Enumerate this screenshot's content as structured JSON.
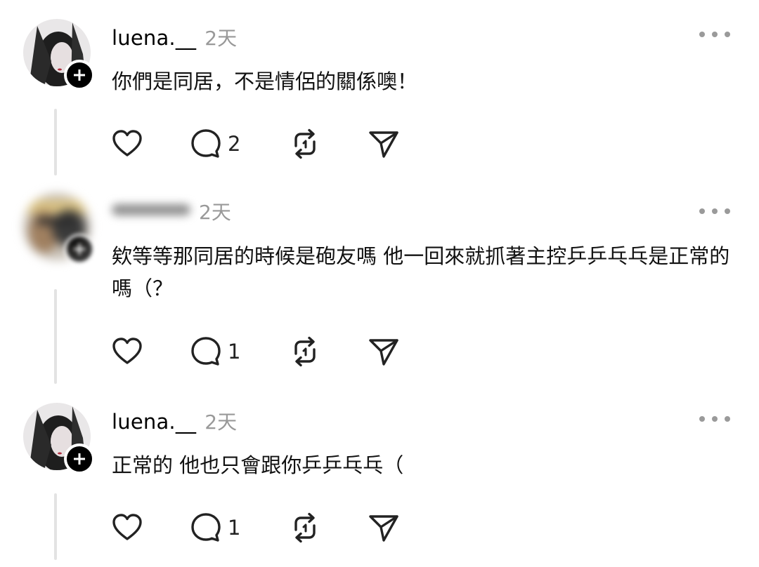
{
  "comments": [
    {
      "username": "luena.__",
      "time": "2天",
      "text": "你們是同居，不是情侶的關係噢！",
      "reply_count": "2"
    },
    {
      "username": "",
      "time": "2天",
      "text": "欸等等那同居的時候是砲友嗎 他一回來就抓著主控乒乒乓乓是正常的嗎（？",
      "reply_count": "1"
    },
    {
      "username": "luena.__",
      "time": "2天",
      "text": "正常的 他也只會跟你乒乒乓乓（",
      "reply_count": "1"
    }
  ],
  "icons": {
    "like": "heart-icon",
    "reply": "comment-bubble-icon",
    "repost": "repost-icon",
    "share": "send-icon",
    "more": "more-dots-icon",
    "follow": "plus-icon"
  },
  "colors": {
    "timestamp": "#999999",
    "thread_line": "#e3e3e3",
    "icon": "#222222"
  }
}
